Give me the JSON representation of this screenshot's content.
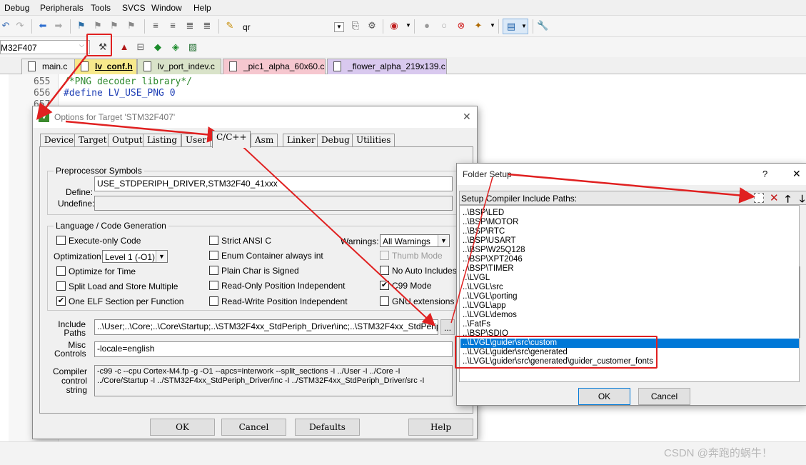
{
  "menu": [
    "Debug",
    "Peripherals",
    "Tools",
    "SVCS",
    "Window",
    "Help"
  ],
  "toolbar": {
    "find_text": "qr",
    "target_select": "M32F407"
  },
  "file_tabs": [
    "main.c",
    "lv_conf.h",
    "lv_port_indev.c",
    "_pic1_alpha_60x60.c",
    "_flower_alpha_219x139.c"
  ],
  "editor": {
    "line_numbers": [
      "655",
      "656",
      "657"
    ],
    "lines": [
      "/*PNG decoder library*/",
      "#define LV_USE_PNG 0"
    ]
  },
  "options_dialog": {
    "title": "Options for Target 'STM32F407'",
    "close_glyph": "✕",
    "tabs": [
      "Device",
      "Target",
      "Output",
      "Listing",
      "User",
      "C/C++",
      "Asm",
      "Linker",
      "Debug",
      "Utilities"
    ],
    "active_tab": "C/C++",
    "preprocessor": {
      "group_label": "Preprocessor Symbols",
      "define_label": "Define:",
      "define_value": "USE_STDPERIPH_DRIVER,STM32F40_41xxx",
      "undefine_label": "Undefine:",
      "undefine_value": ""
    },
    "langgen": {
      "group_label": "Language / Code Generation",
      "execute_only": "Execute-only Code",
      "optimization_label": "Optimization:",
      "optimization_value": "Level 1 (-O1)",
      "optimize_time": "Optimize for Time",
      "split_load": "Split Load and Store Multiple",
      "one_elf": "One ELF Section per Function",
      "strict_ansi": "Strict ANSI C",
      "enum_container": "Enum Container always int",
      "plain_char": "Plain Char is Signed",
      "ro_pi": "Read-Only Position Independent",
      "rw_pi": "Read-Write Position Independent",
      "warnings_label": "Warnings:",
      "warnings_value": "All Warnings",
      "thumb_mode": "Thumb Mode",
      "no_auto_includes": "No Auto Includes",
      "c99_mode": "C99 Mode",
      "gnu_extensions": "GNU extensions",
      "check_glyph": "✔"
    },
    "include_paths_label": "Include\nPaths",
    "include_paths_value": "..\\User;..\\Core;..\\Core\\Startup;..\\STM32F4xx_StdPeriph_Driver\\inc;..\\STM32F4xx_StdPeriph_Driver",
    "browse_label": "...",
    "misc_label": "Misc\nControls",
    "misc_value": "-locale=english",
    "compiler_label": "Compiler\ncontrol\nstring",
    "compiler_line1": "-c99 -c --cpu Cortex-M4.fp -g -O1 --apcs=interwork --split_sections -I ../User -I ../Core -I",
    "compiler_line2": "../Core/Startup -I ../STM32F4xx_StdPeriph_Driver/inc -I ../STM32F4xx_StdPeriph_Driver/src -I",
    "buttons": [
      "OK",
      "Cancel",
      "Defaults",
      "Help"
    ]
  },
  "folder_dialog": {
    "title": "Folder Setup",
    "help_glyph": "?",
    "close_glyph": "✕",
    "header_label": "Setup Compiler Include Paths:",
    "paths": [
      "..\\BSP\\LED",
      "..\\BSP\\MOTOR",
      "..\\BSP\\RTC",
      "..\\BSP\\USART",
      "..\\BSP\\W25Q128",
      "..\\BSP\\XPT2046",
      "..\\BSP\\TIMER",
      "..\\LVGL",
      "..\\LVGL\\src",
      "..\\LVGL\\porting",
      "..\\LVGL\\app",
      "..\\LVGL\\demos",
      "..\\FatFs",
      "..\\BSP\\SDIO",
      "..\\LVGL\\guider\\src\\custom",
      "..\\LVGL\\guider\\src\\generated",
      "..\\LVGL\\guider\\src\\generated\\guider_customer_fonts"
    ],
    "selected_index": 14,
    "ok_label": "OK",
    "cancel_label": "Cancel"
  },
  "watermark": "CSDN @奔跑的蜗牛！",
  "colors": {
    "accent_red": "#e02020",
    "selection": "#0078d7",
    "tab_active": "#f7e98c"
  }
}
